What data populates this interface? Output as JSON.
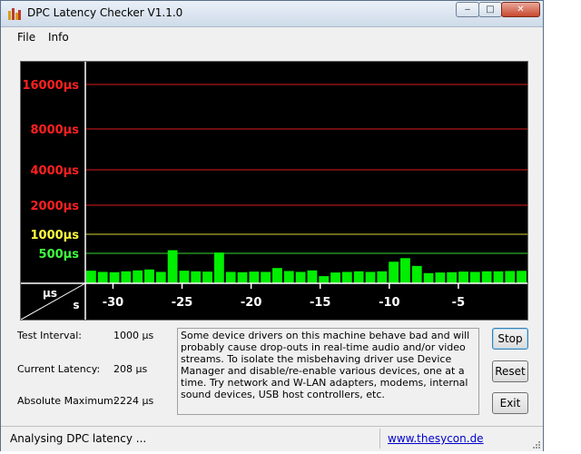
{
  "window": {
    "title": "DPC Latency Checker V1.1.0",
    "controls": {
      "minimize": "‒",
      "maximize": "□",
      "close": "✕"
    }
  },
  "menu": [
    "File",
    "Info"
  ],
  "chart_data": {
    "type": "bar",
    "ylabel": "µs",
    "xlabel": "s",
    "y_ticks": [
      {
        "label": "16000µs",
        "value": 16000,
        "color": "#ff2020"
      },
      {
        "label": "8000µs",
        "value": 8000,
        "color": "#ff2020"
      },
      {
        "label": "4000µs",
        "value": 4000,
        "color": "#ff2020"
      },
      {
        "label": "2000µs",
        "value": 2000,
        "color": "#ff2020"
      },
      {
        "label": "1000µs",
        "value": 1000,
        "color": "#ffff40"
      },
      {
        "label": "500µs",
        "value": 500,
        "color": "#40ff40"
      }
    ],
    "x_ticks": [
      {
        "label": "-30",
        "value": -30
      },
      {
        "label": "-25",
        "value": -25
      },
      {
        "label": "-20",
        "value": -20
      },
      {
        "label": "-15",
        "value": -15
      },
      {
        "label": "-10",
        "value": -10
      },
      {
        "label": "-5",
        "value": -5
      }
    ],
    "xlim": [
      -32,
      0
    ],
    "values": [
      210,
      190,
      185,
      200,
      215,
      230,
      190,
      560,
      210,
      200,
      195,
      515,
      190,
      185,
      195,
      190,
      255,
      205,
      190,
      215,
      120,
      180,
      190,
      200,
      190,
      200,
      360,
      420,
      290,
      170,
      180,
      185,
      195,
      190,
      200,
      200,
      205,
      208
    ],
    "bar_color": "#00ee00",
    "grid": true
  },
  "stats": {
    "test_interval_label": "Test Interval:",
    "test_interval_value": "1000 µs",
    "current_latency_label": "Current Latency:",
    "current_latency_value": "208 µs",
    "absolute_maximum_label": "Absolute Maximum:",
    "absolute_maximum_value": "2224 µs"
  },
  "info_text": "Some device drivers on this machine behave bad and will probably cause drop-outs in real-time audio and/or video streams. To isolate the misbehaving driver use Device Manager and disable/re-enable various devices, one at a time. Try network and W-LAN adapters, modems, internal sound devices, USB host controllers, etc.",
  "buttons": {
    "stop": "Stop",
    "reset": "Reset",
    "exit": "Exit"
  },
  "status": {
    "text": "Analysing DPC latency ...",
    "link": "www.thesycon.de"
  }
}
